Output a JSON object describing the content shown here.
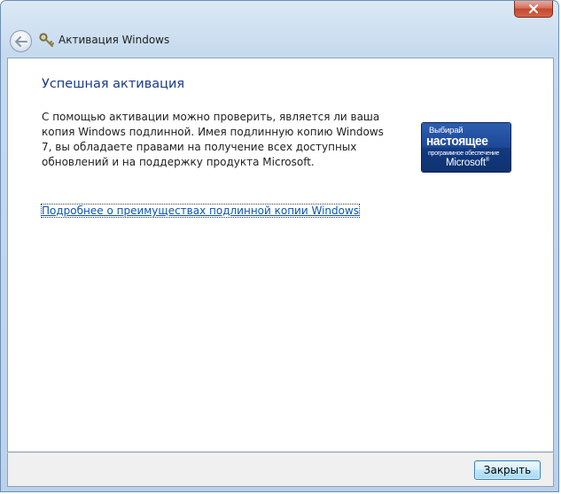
{
  "window": {
    "title": "Активация Windows",
    "close_icon": "close-icon",
    "back_icon": "back-arrow-icon",
    "title_icon": "activation-key-icon"
  },
  "content": {
    "heading": "Успешная активация",
    "description_lines": [
      "С помощью активации можно проверить, является ли ваша",
      "копия Windows подлинной. Имея подлинную копию Windows",
      "7, вы обладаете правами на получение всех доступных",
      "обновлений и на поддержку продукта Microsoft."
    ],
    "logo": {
      "line1": "Выбирай",
      "line2": "настоящее",
      "line3": "программное обеспечение",
      "line4": "Microsoft",
      "registered_mark": "®"
    },
    "link": "Подробнее о преимуществах подлинной копии Windows"
  },
  "footer": {
    "close_button": "Закрыть"
  },
  "colors": {
    "heading": "#1a3a8a",
    "link": "#0a56b4",
    "logo_bg": "#1d4896"
  }
}
